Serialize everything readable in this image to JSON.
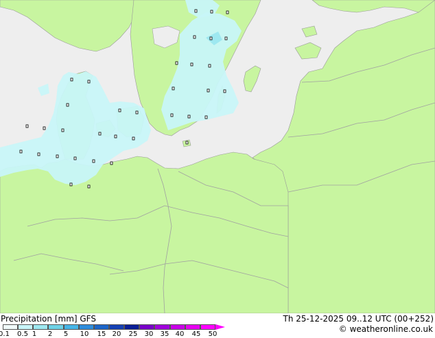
{
  "map": {
    "colors": {
      "land": "#c8f5a0",
      "sea": "#eeeeee",
      "precip_light": "#c8f5f8",
      "precip_mid": "#9ee8f0",
      "border": "#a0a0a0",
      "coast": "#999999"
    }
  },
  "footer": {
    "title": "Precipitation [mm]  GFS",
    "valid_time": "Th 25-12-2025 09..12 UTC (00+252)",
    "credit": "© weatheronline.co.uk",
    "legend_ticks": [
      "0.1",
      "0.5",
      "1",
      "2",
      "5",
      "10",
      "15",
      "20",
      "25",
      "30",
      "35",
      "40",
      "45",
      "50"
    ],
    "legend_colors": [
      "#f0fafa",
      "#c8f5f8",
      "#9ee8f0",
      "#6ed2e6",
      "#46b4e6",
      "#2e8cdc",
      "#1c64c8",
      "#1440b4",
      "#0a1e96",
      "#7800c8",
      "#a000dc",
      "#c800e6",
      "#e600f0",
      "#ff00ff"
    ]
  }
}
